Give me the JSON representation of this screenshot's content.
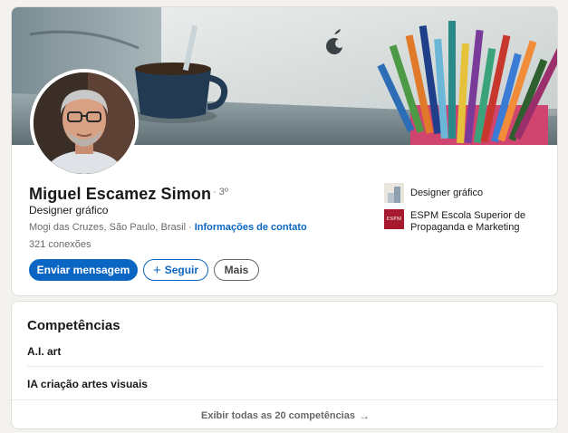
{
  "profile": {
    "name": "Miguel Escamez Simon",
    "degree": "· 3º",
    "headline": "Designer gráfico",
    "location": "Mogi das Cruzes, São Paulo, Brasil",
    "separator": "·",
    "contact_link": "Informações de contato",
    "connections": "321 conexões"
  },
  "actions": {
    "message_label": "Enviar mensagem",
    "follow_label": "Seguir",
    "follow_icon": "+",
    "more_label": "Mais"
  },
  "experience": [
    {
      "title": "Designer gráfico",
      "logo": "company-logo-icon"
    },
    {
      "title_line1": "ESPM Escola Superior de",
      "title_line2": "Propaganda e Marketing",
      "logo_text": "ESPM",
      "logo_color": "#a6192e"
    }
  ],
  "skills": {
    "title": "Competências",
    "items": [
      "A.I. art",
      "IA criação artes visuais"
    ],
    "show_all_label": "Exibir todas as 20 competências",
    "show_all_icon": "→"
  },
  "colors": {
    "accent": "#0a66c2",
    "background": "#f4f2ee",
    "espm": "#a6192e"
  }
}
